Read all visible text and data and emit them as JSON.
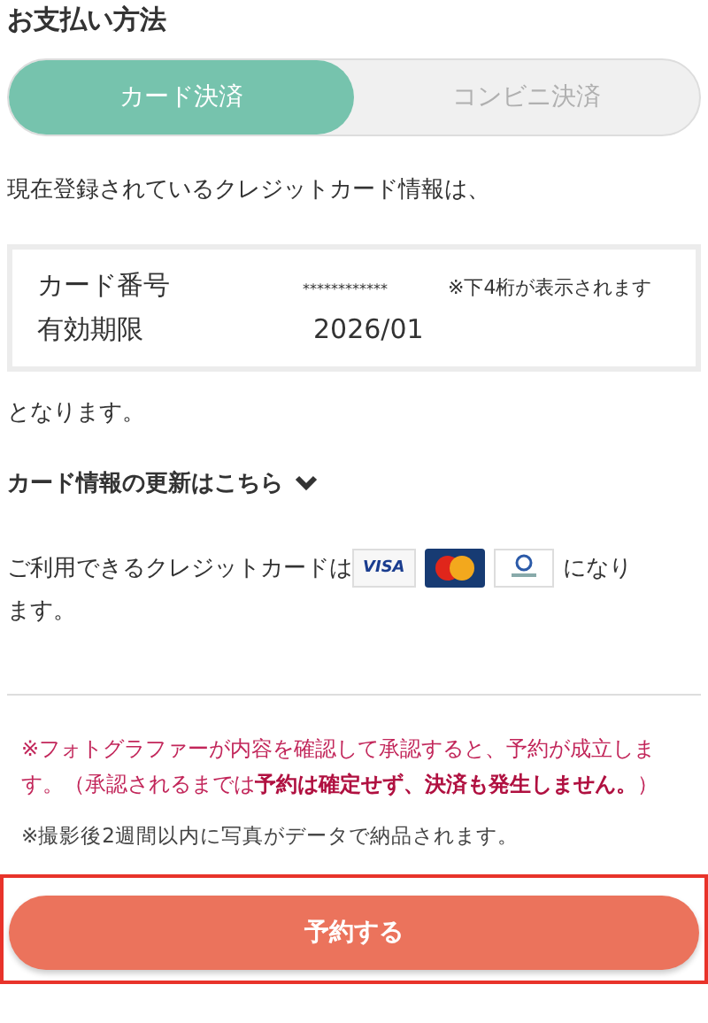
{
  "heading": "お支払い方法",
  "payment_tabs": [
    {
      "label": "カード決済",
      "selected": true
    },
    {
      "label": "コンビニ決済",
      "selected": false
    }
  ],
  "intro": "現在登録されているクレジットカード情報は、",
  "card_info": {
    "number_label": "カード番号",
    "number_value": "************",
    "number_note": "※下4桁が表示されます",
    "expiry_label": "有効期限",
    "expiry_value": "2026/01"
  },
  "outro": "となります。",
  "update_link": {
    "label": "カード情報の更新はこちら",
    "expanded": false
  },
  "accepted_before": "ご利用できるクレジットカードは",
  "accepted_cards": [
    {
      "kind": "visa",
      "label": "VISA"
    },
    {
      "kind": "mastercard"
    },
    {
      "kind": "diners"
    }
  ],
  "accepted_after": "になり",
  "accepted_after_continued": "ます。",
  "approval_note": "※フォトグラファーが内容を確認して承認すると、予約が成立します。（承認されるまでは**予約は確定せず、決済も発生しません。**）",
  "delivery_note": "※撮影後2週間以内に写真がデータで納品されます。",
  "submit_button": {
    "label": "予約する",
    "highlighted": true
  }
}
